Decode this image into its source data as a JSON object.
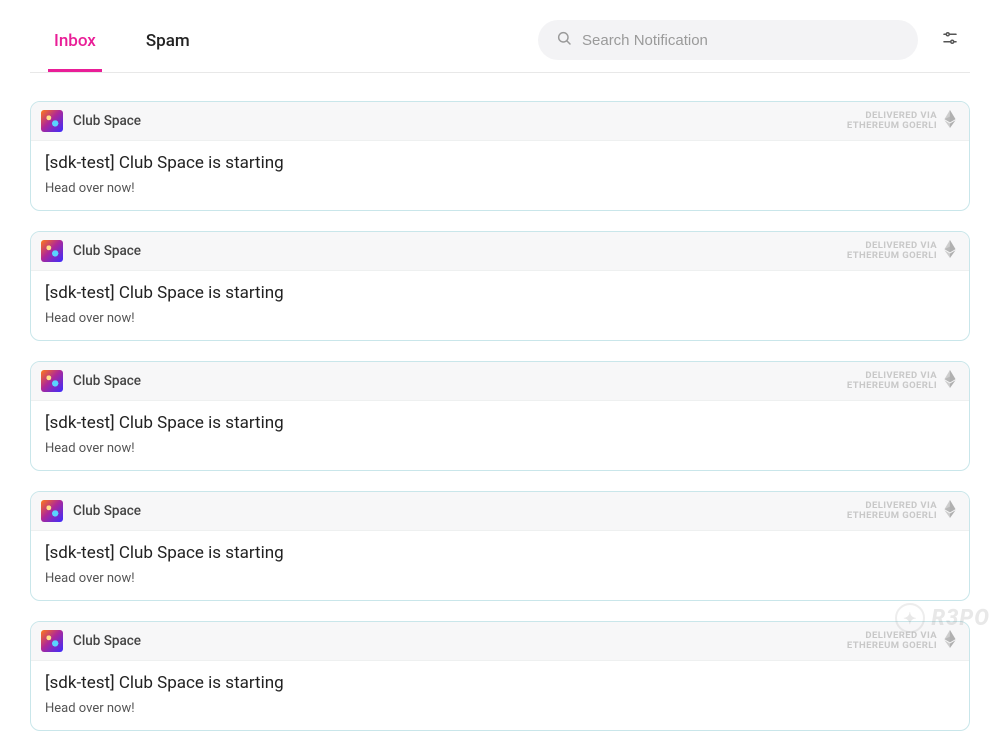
{
  "tabs": {
    "inbox": "Inbox",
    "spam": "Spam"
  },
  "search": {
    "placeholder": "Search Notification"
  },
  "delivery": {
    "line1": "DELIVERED VIA",
    "line2": "ETHEREUM GOERLI"
  },
  "notifications": [
    {
      "sender": "Club Space",
      "title": "[sdk-test] Club Space is starting",
      "desc": "Head over now!"
    },
    {
      "sender": "Club Space",
      "title": "[sdk-test] Club Space is starting",
      "desc": "Head over now!"
    },
    {
      "sender": "Club Space",
      "title": "[sdk-test] Club Space is starting",
      "desc": "Head over now!"
    },
    {
      "sender": "Club Space",
      "title": "[sdk-test] Club Space is starting",
      "desc": "Head over now!"
    },
    {
      "sender": "Club Space",
      "title": "[sdk-test] Club Space is starting",
      "desc": "Head over now!"
    }
  ],
  "watermark": "R3PO"
}
